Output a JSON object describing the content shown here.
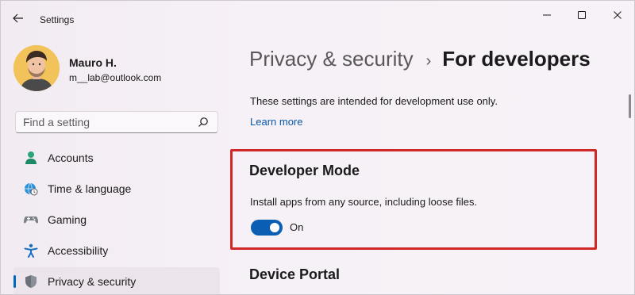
{
  "titlebar": {
    "app_title": "Settings"
  },
  "profile": {
    "name": "Mauro H.",
    "email": "m__lab@outlook.com"
  },
  "search": {
    "placeholder": "Find a setting"
  },
  "sidebar": {
    "items": [
      {
        "label": "Accounts",
        "icon": "accounts-icon",
        "selected": false
      },
      {
        "label": "Time & language",
        "icon": "globe-clock-icon",
        "selected": false
      },
      {
        "label": "Gaming",
        "icon": "gamepad-icon",
        "selected": false
      },
      {
        "label": "Accessibility",
        "icon": "accessibility-icon",
        "selected": false
      },
      {
        "label": "Privacy & security",
        "icon": "shield-icon",
        "selected": true
      }
    ]
  },
  "main": {
    "breadcrumb_parent": "Privacy & security",
    "breadcrumb_sep": "›",
    "breadcrumb_current": "For developers",
    "description": "These settings are intended for development use only.",
    "learn_more": "Learn more",
    "developer_mode": {
      "title": "Developer Mode",
      "description": "Install apps from any source, including loose files.",
      "toggle_state": "On",
      "enabled": true
    },
    "device_portal_title": "Device Portal"
  },
  "colors": {
    "accent": "#0a5fb4",
    "highlight_border": "#d02828",
    "link": "#0a57a8"
  }
}
